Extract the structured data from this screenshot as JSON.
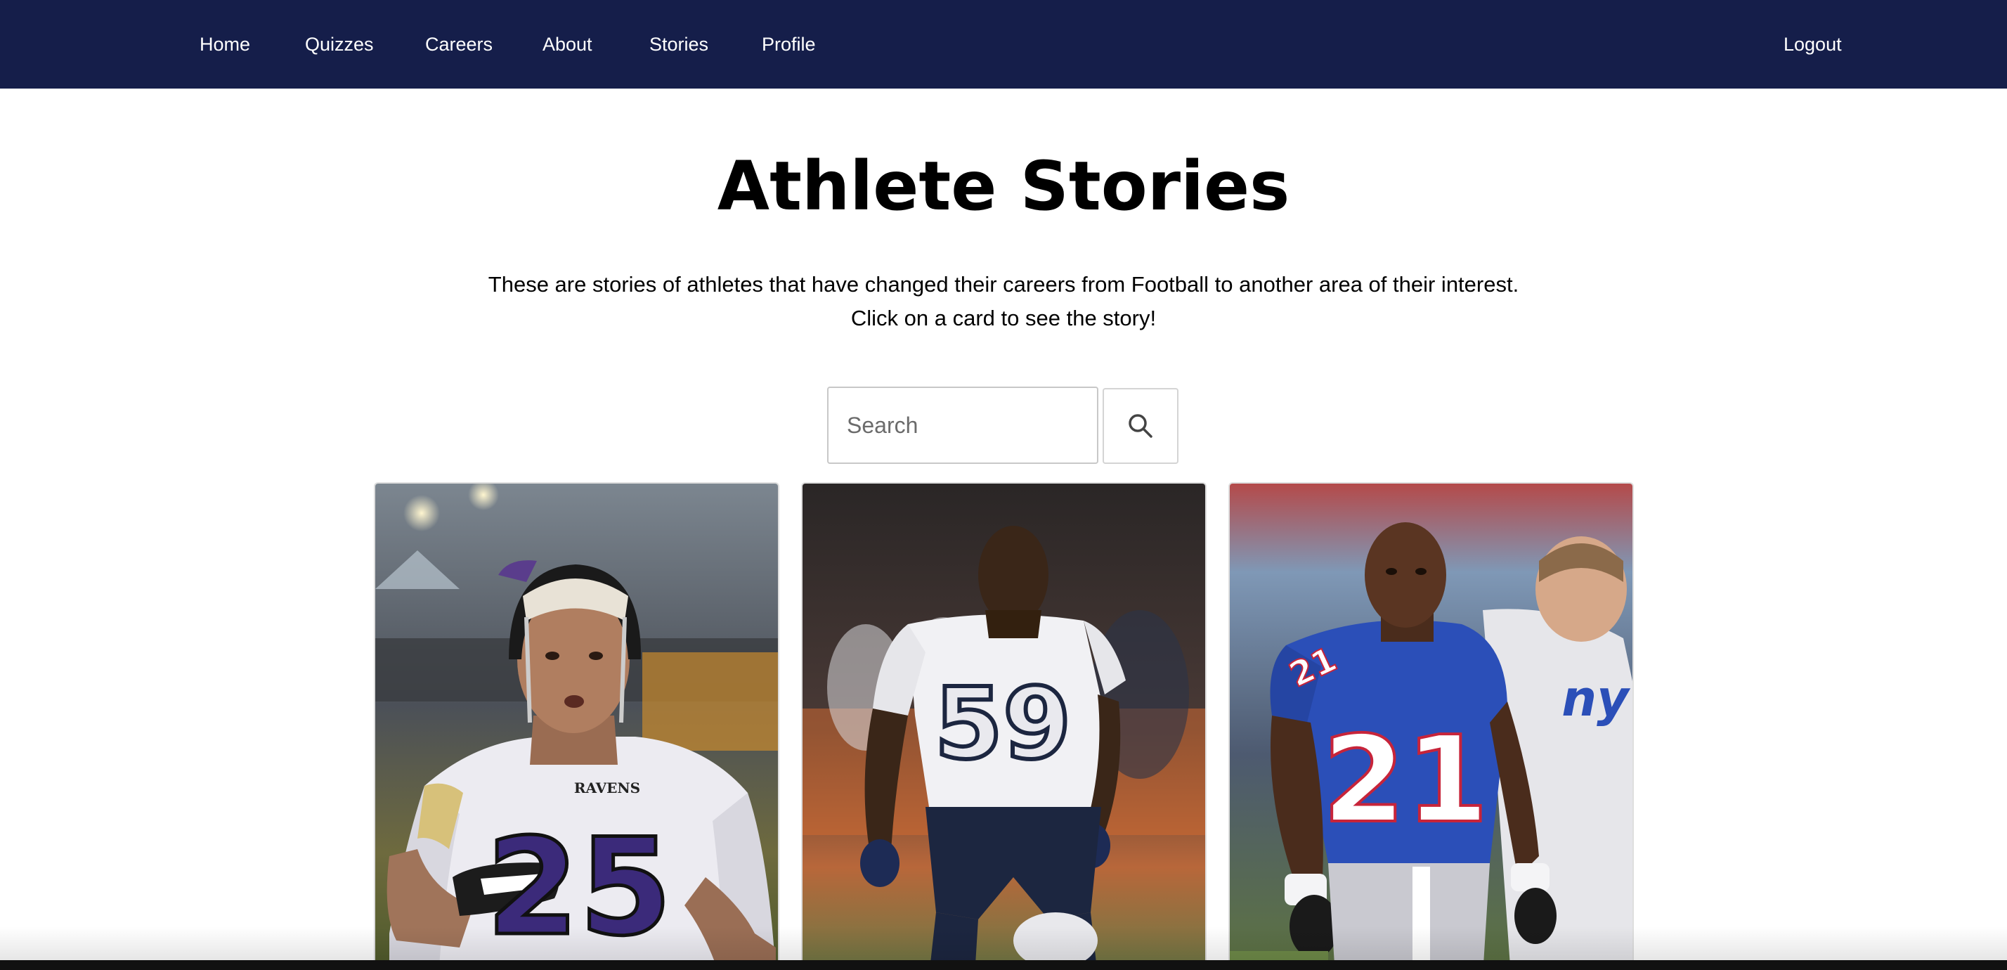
{
  "nav": {
    "links": [
      "Home",
      "Quizzes",
      "Careers",
      "About",
      "Stories",
      "Profile"
    ],
    "logout": "Logout",
    "background": "#151e4a"
  },
  "page": {
    "title": "Athlete Stories",
    "intro_line1": "These are stories of athletes that have changed their careers from Football to another area of their interest.",
    "intro_line2": "Click on a card to see the story!"
  },
  "search": {
    "placeholder": "Search",
    "value": "",
    "button_icon": "search-icon"
  },
  "cards": [
    {
      "jersey_number": "25",
      "jersey_text": "RAVENS",
      "team_color": "#3b2a7a"
    },
    {
      "jersey_number": "59",
      "jersey_text": "",
      "team_color": "#1c2a4a"
    },
    {
      "jersey_number": "21",
      "jersey_text": "ny",
      "team_color": "#2b4fb8"
    }
  ]
}
